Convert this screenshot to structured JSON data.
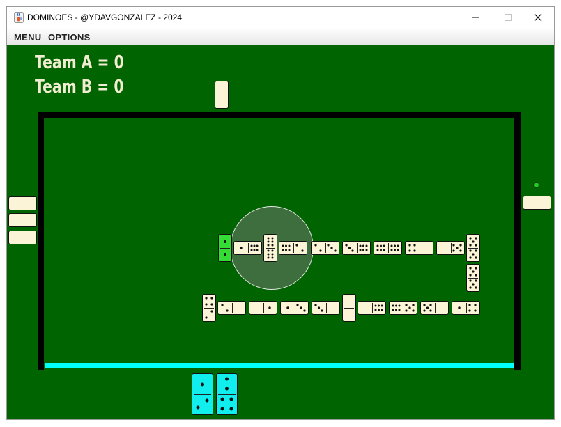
{
  "window": {
    "title": "DOMINOES - @YDAVGONZALEZ - 2024",
    "icon": "java-cup-icon",
    "controls": [
      "minimize-icon",
      "maximize-icon",
      "close-icon"
    ]
  },
  "menu": {
    "items": [
      "MENU",
      "OPTIONS"
    ]
  },
  "scoreboard": [
    {
      "label": "Team A  =  0",
      "team": "Team A",
      "score": 0
    },
    {
      "label": "Team B  =  0",
      "team": "Team B",
      "score": 0
    }
  ],
  "colors": {
    "felt": "#006400",
    "tile": "#fcf4d6",
    "player_rail": "#00ffff",
    "current_tile": "#33dd33",
    "player_tiles": "#11eeee",
    "highlight": "#3e6e3e"
  },
  "opponents": {
    "top_hand_count": 1,
    "left_hand_count": 3,
    "right_hand_count": 1,
    "right_player_turn_indicator": true
  },
  "board": {
    "top_row": [
      {
        "pips": [
          2,
          2
        ],
        "double": true,
        "highlighted": true
      },
      {
        "pips": [
          1,
          6
        ]
      },
      {
        "pips": [
          6,
          6
        ],
        "double": true
      },
      {
        "pips": [
          6,
          2
        ]
      },
      {
        "pips": [
          2,
          3
        ]
      },
      {
        "pips": [
          3,
          6
        ]
      },
      {
        "pips": [
          6,
          6
        ]
      },
      {
        "pips": [
          4,
          0
        ]
      },
      {
        "pips": [
          0,
          5
        ]
      },
      {
        "pips": [
          5,
          5
        ],
        "double": true
      }
    ],
    "right_column": [
      {
        "pips": [
          5,
          5
        ]
      }
    ],
    "bottom_row": [
      {
        "pips": [
          4,
          2
        ],
        "double": true
      },
      {
        "pips": [
          2,
          0
        ]
      },
      {
        "pips": [
          0,
          1
        ]
      },
      {
        "pips": [
          1,
          3
        ]
      },
      {
        "pips": [
          3,
          0
        ]
      },
      {
        "pips": [
          0,
          0
        ],
        "double": true
      },
      {
        "pips": [
          0,
          6
        ]
      },
      {
        "pips": [
          6,
          5
        ]
      },
      {
        "pips": [
          5,
          0
        ]
      },
      {
        "pips": [
          1,
          4
        ]
      }
    ]
  },
  "player_hand": [
    {
      "pips": [
        2,
        2
      ]
    },
    {
      "pips": [
        2,
        4
      ]
    }
  ]
}
